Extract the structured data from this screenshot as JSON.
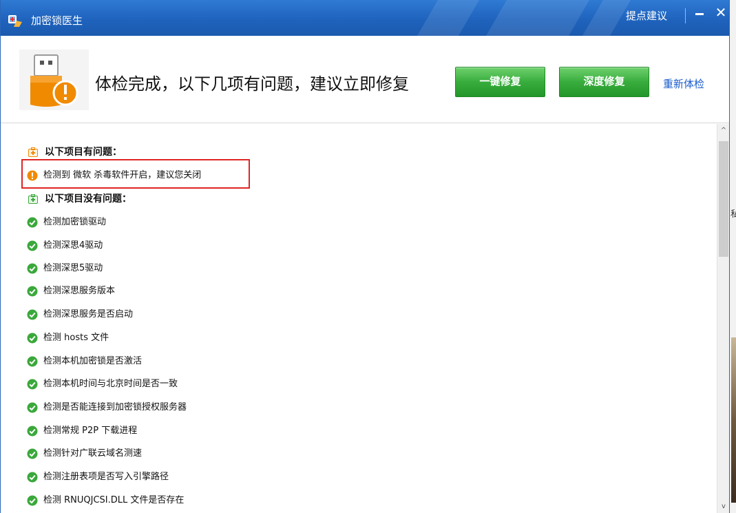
{
  "window": {
    "title": "加密锁医生",
    "suggest_link": "提点建议",
    "minimize_icon": "minimize-icon",
    "close_icon": "close-icon",
    "close_glyph": "✕"
  },
  "banner": {
    "message": "体检完成，以下几项有问题，建议立即修复",
    "one_click_fix": "一键修复",
    "deep_fix": "深度修复",
    "recheck": "重新体检"
  },
  "sections": {
    "problems_title": "以下项目有问题：",
    "ok_title": "以下项目没有问题："
  },
  "problems": [
    {
      "label": "检测到 微软 杀毒软件开启，建议您关闭",
      "status": "warning"
    }
  ],
  "ok_items": [
    {
      "label": "检测加密锁驱动"
    },
    {
      "label": "检测深思4驱动"
    },
    {
      "label": "检测深思5驱动"
    },
    {
      "label": "检测深思服务版本"
    },
    {
      "label": "检测深思服务是否启动"
    },
    {
      "label": "检测 hosts 文件"
    },
    {
      "label": "检测本机加密锁是否激活"
    },
    {
      "label": "检测本机时间与北京时间是否一致"
    },
    {
      "label": "检测是否能连接到加密锁授权服务器"
    },
    {
      "label": "检测常规 P2P 下载进程"
    },
    {
      "label": "检测针对广联云域名测速"
    },
    {
      "label": "检测注册表项是否写入引擎路径"
    },
    {
      "label": "检测 RNUQJCSI.DLL 文件是否存在"
    }
  ],
  "scrollbar": {
    "up_glyph": "^",
    "down_glyph": "v"
  },
  "outside_text": "私",
  "colors": {
    "titlebar": "#1f63bd",
    "green_button": "#38ad3d",
    "link": "#1a5ccc",
    "warning": "#f08a00",
    "ok": "#3aa83a",
    "highlight_border": "#e02424"
  }
}
